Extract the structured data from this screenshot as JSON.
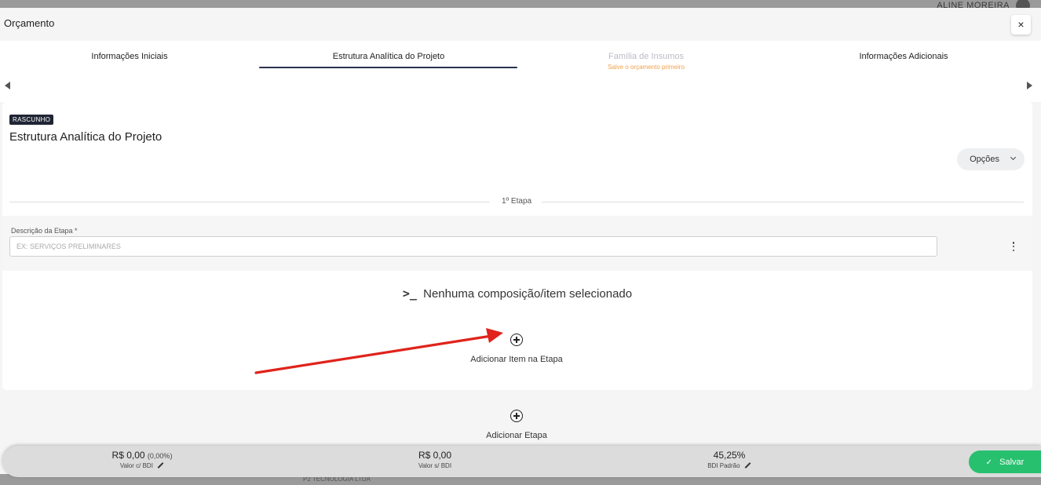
{
  "background": {
    "user_name": "ALINE MOREIRA",
    "company": "P2 TECNOLOGIA LTDA"
  },
  "modal": {
    "title": "Orçamento",
    "close_label": "×"
  },
  "tabs": [
    {
      "label": "Informações Iniciais",
      "active": false,
      "disabled": false
    },
    {
      "label": "Estrutura Analítica do Projeto",
      "active": true,
      "disabled": false
    },
    {
      "label": "Família de Insumos",
      "active": false,
      "disabled": true,
      "sub": "Salve o orçamento primeiro"
    },
    {
      "label": "Informações Adicionais",
      "active": false,
      "disabled": false
    }
  ],
  "card": {
    "status_badge": "RASCUNHO",
    "title": "Estrutura Analítica do Projeto",
    "options_label": "Opções",
    "stage_divider": "1º Etapa",
    "stage_field_label": "Descrição da Etapa *",
    "stage_field_placeholder": "EX: SERVIÇOS PRELIMINARES",
    "stage_field_value": "",
    "empty_state_icon": ">_",
    "empty_state_text": "Nenhuma composição/item selecionado",
    "add_item_label": "Adicionar Item na Etapa"
  },
  "add_stage_label": "Adicionar Etapa",
  "footer": {
    "value_with_bdi": "R$ 0,00",
    "value_with_bdi_pct": "(0,00%)",
    "value_with_bdi_label": "Valor c/ BDI",
    "value_without_bdi": "R$ 0,00",
    "value_without_bdi_label": "Valor s/ BDI",
    "bdi_default": "45,25%",
    "bdi_default_label": "BDI Padrão",
    "save_label": "Salvar"
  },
  "colors": {
    "accent_dark": "#2b3250",
    "warning": "#f0a14a",
    "success": "#27c06f",
    "arrow": "#e0231b"
  }
}
